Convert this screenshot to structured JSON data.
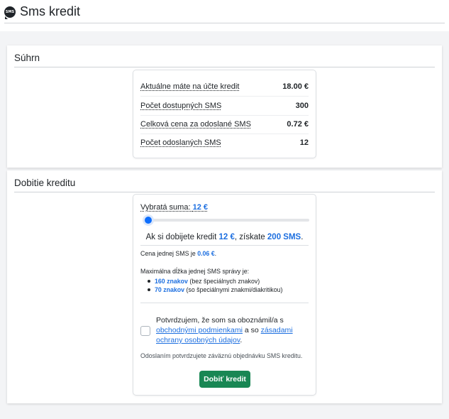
{
  "header": {
    "icon_text": "SMS",
    "title": "Sms kredit"
  },
  "summary": {
    "title": "Súhrn",
    "rows": [
      {
        "label": "Aktuálne máte na účte kredit",
        "value": "18.00 €"
      },
      {
        "label": "Počet dostupných SMS",
        "value": "300"
      },
      {
        "label": "Celková cena za odoslané SMS",
        "value": "0.72 €"
      },
      {
        "label": "Počet odoslaných SMS",
        "value": "12"
      }
    ]
  },
  "topup": {
    "title": "Dobitie kreditu",
    "selected_label": "Vybratá suma:",
    "selected_amount": "12 €",
    "slider_level": 0,
    "offer_prefix": "Ak si dobijete kredit ",
    "offer_amount": "12 €",
    "offer_mid": ", získate ",
    "offer_sms": "200 SMS",
    "offer_suffix": ".",
    "price_prefix": "Cena jednej SMS je ",
    "price_value": "0.06 €",
    "price_suffix": ".",
    "maxlen_intro": "Maximálna dĺžka jednej SMS správy je:",
    "limits": [
      {
        "strong": "160 znakov",
        "rest": " (bez špeciálnych znakov)"
      },
      {
        "strong": "70 znakov",
        "rest": " (so špeciálnymi znakmi/diakritikou)"
      }
    ],
    "consent_prefix": "Potvrdzujem, že som sa oboznámil/a s ",
    "consent_link1": "obchodnými podmienkami",
    "consent_mid": " a so ",
    "consent_link2": "zásadami ochrany osobných údajov",
    "consent_suffix": ".",
    "note": "Odoslaním potvrdzujete záväznú objednávku SMS kreditu.",
    "buy_label": "Dobiť kredit",
    "accent_color": "#1d6fe0",
    "button_color": "#198754"
  }
}
